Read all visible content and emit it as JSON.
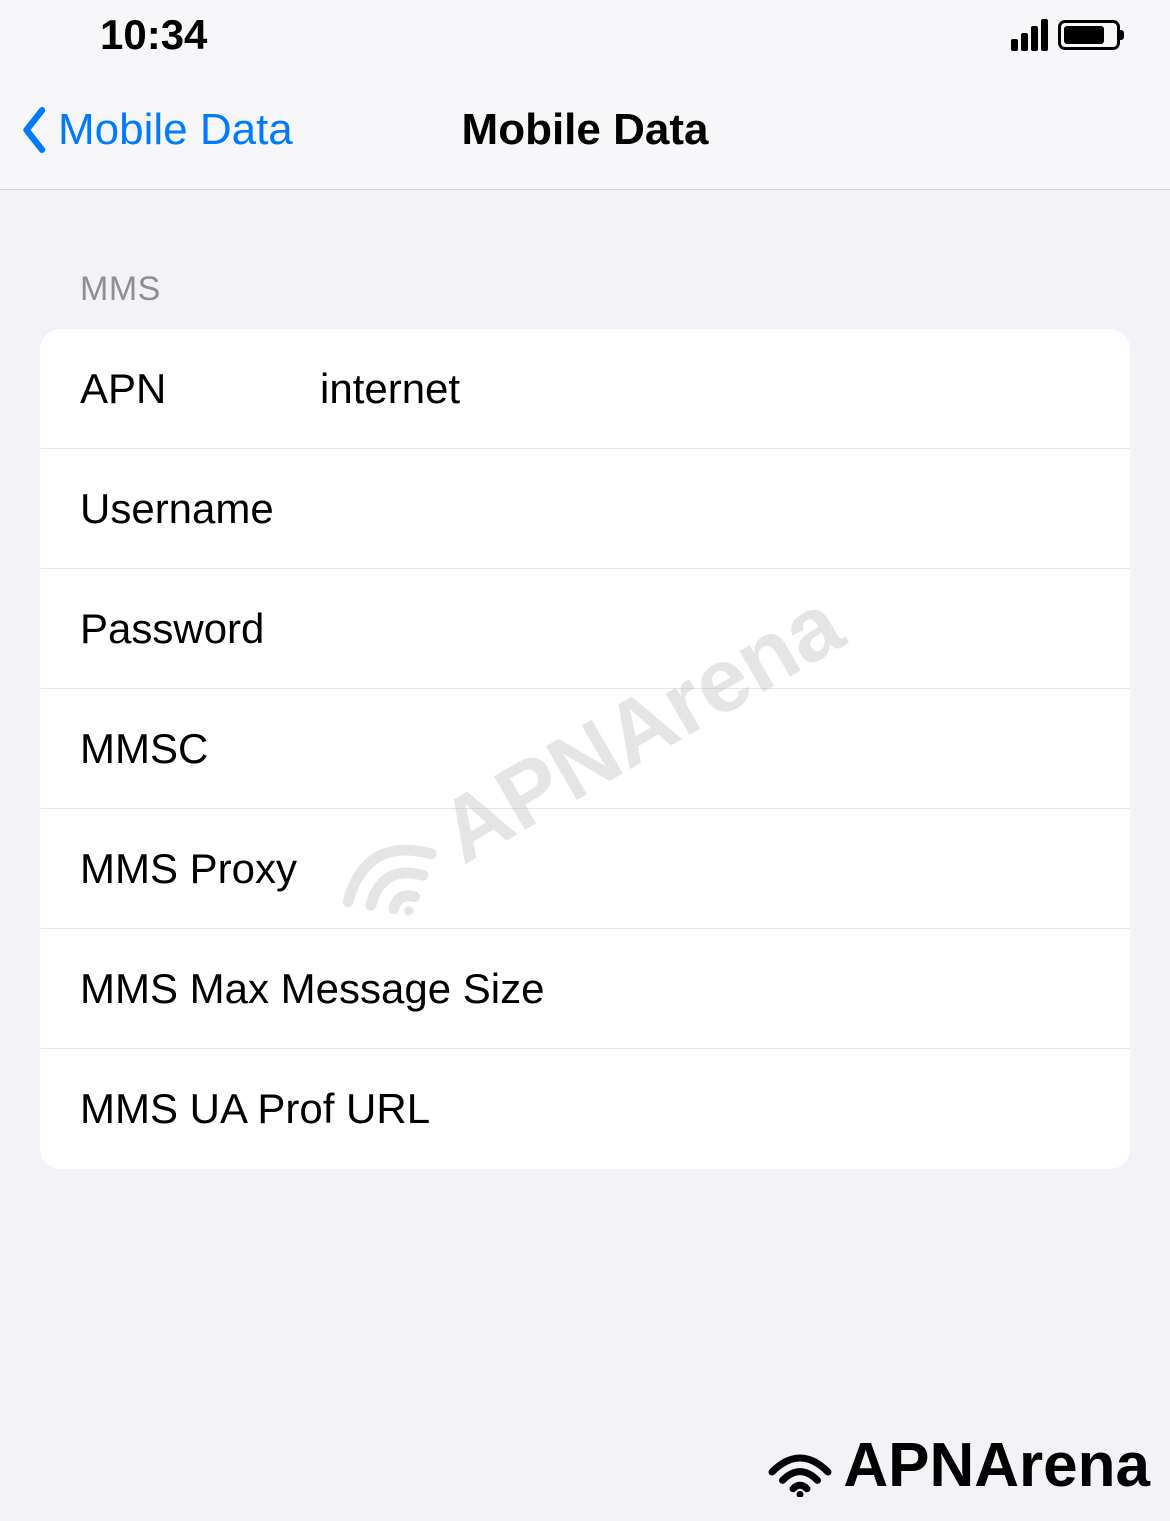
{
  "statusBar": {
    "time": "10:34"
  },
  "navBar": {
    "backLabel": "Mobile Data",
    "title": "Mobile Data"
  },
  "section": {
    "header": "MMS"
  },
  "fields": {
    "apn": {
      "label": "APN",
      "value": "internet"
    },
    "username": {
      "label": "Username",
      "value": ""
    },
    "password": {
      "label": "Password",
      "value": ""
    },
    "mmsc": {
      "label": "MMSC",
      "value": ""
    },
    "mmsProxy": {
      "label": "MMS Proxy",
      "value": ""
    },
    "mmsMaxSize": {
      "label": "MMS Max Message Size",
      "value": ""
    },
    "mmsUaProf": {
      "label": "MMS UA Prof URL",
      "value": ""
    }
  },
  "watermark": {
    "text": "APNArena"
  }
}
